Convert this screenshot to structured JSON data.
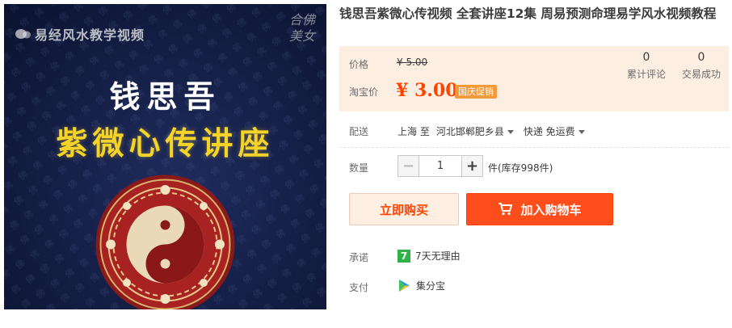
{
  "image": {
    "watermark": "易经风水教学视频",
    "seal": "合佛美女",
    "name": "钱思吾",
    "subtitle": "紫微心传讲座"
  },
  "title": "钱思吾紫微心传视频 全套讲座12集 周易预测命理易学风水视频教程",
  "price": {
    "label": "价格",
    "original": "¥ 5.00",
    "taobao_label": "淘宝价",
    "current": "¥ 3.00",
    "promo": "国庆促销",
    "reviews_count": "0",
    "reviews_label": "累计评论",
    "deals_count": "0",
    "deals_label": "交易成功"
  },
  "delivery": {
    "label": "配送",
    "from": "上海 至",
    "to": "河北邯郸肥乡县",
    "shipping": "快递 免运费"
  },
  "quantity": {
    "label": "数量",
    "value": "1",
    "minus": "−",
    "plus": "+",
    "stock": "件(库存998件)"
  },
  "buttons": {
    "buy_now": "立即购买",
    "add_to_cart": "加入购物车"
  },
  "promise": {
    "label": "承诺",
    "badge": "7",
    "text": "7天无理由"
  },
  "payment": {
    "label": "支付",
    "method": "集分宝"
  },
  "colors": {
    "accent": "#ff4400",
    "cart_button": "#ff4e1c",
    "price_panel_bg": "#fdeee2",
    "poster_title": "#f5d328"
  }
}
